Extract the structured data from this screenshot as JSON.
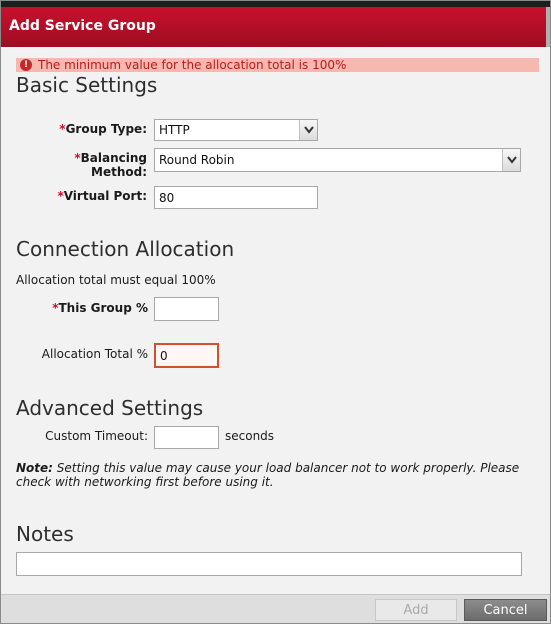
{
  "dialog": {
    "title": "Add Service Group"
  },
  "error": {
    "message": "The minimum value for the allocation total is 100%",
    "icon": "error-icon"
  },
  "basic": {
    "heading": "Basic Settings",
    "group_type_label": "Group Type:",
    "group_type_value": "HTTP",
    "balancing_label_1": "Balancing",
    "balancing_label_2": "Method:",
    "balancing_value": "Round Robin",
    "virtual_port_label": "Virtual Port:",
    "virtual_port_value": "80",
    "required_mark": "*"
  },
  "allocation": {
    "heading": "Connection Allocation",
    "hint": "Allocation total must equal 100%",
    "this_group_label": "This Group %",
    "this_group_value": "",
    "total_label": "Allocation Total %",
    "total_value": "0"
  },
  "advanced": {
    "heading": "Advanced Settings",
    "timeout_label": "Custom Timeout:",
    "timeout_value": "",
    "timeout_unit": "seconds",
    "note_prefix": "Note:",
    "note_text": " Setting this value may cause your load balancer not to work properly. Please check with networking first before using it."
  },
  "notes": {
    "heading": "Notes",
    "value": ""
  },
  "footer": {
    "add_label": "Add",
    "cancel_label": "Cancel"
  },
  "colors": {
    "titlebar": "#c8102e",
    "error_bg": "#f7b8b0",
    "error_text": "#b71c1c",
    "required": "#c8102e"
  }
}
